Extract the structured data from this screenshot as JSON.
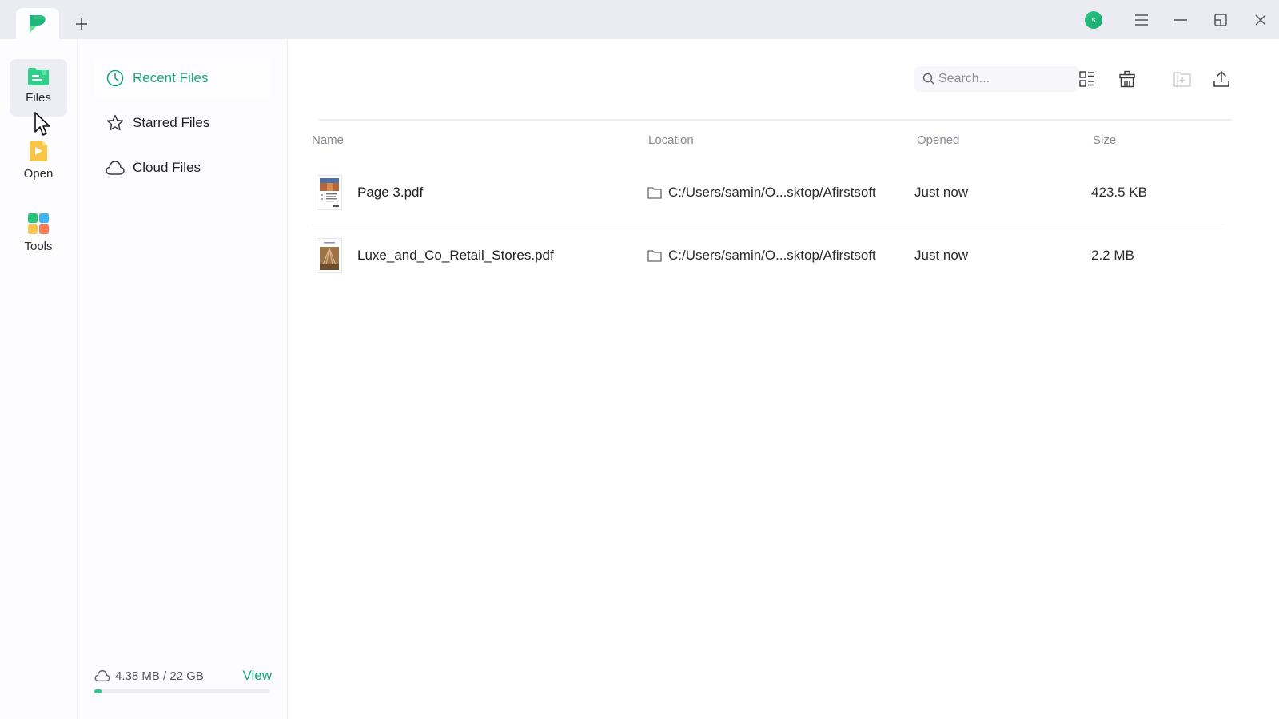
{
  "titlebar": {
    "add_tab_label": "+",
    "avatar_initial": "s",
    "controls": [
      "menu",
      "minimize",
      "restore",
      "close"
    ]
  },
  "colors": {
    "accent": "#1aa879",
    "titlebar_bg": "#ebebf3",
    "files_icon": "#2fd08a",
    "open_icon": "#f8c549",
    "tools_green": "#22c77a",
    "tools_blue": "#3fb4f5",
    "tools_yellow": "#f8c549",
    "tools_orange": "#fb7b55"
  },
  "rail": {
    "items": [
      {
        "label": "Files",
        "icon": "files-folder-icon",
        "active": true
      },
      {
        "label": "Open",
        "icon": "open-file-icon",
        "active": false
      },
      {
        "label": "Tools",
        "icon": "tools-grid-icon",
        "active": false
      }
    ]
  },
  "sidebar": {
    "items": [
      {
        "label": "Recent Files",
        "icon": "clock-icon",
        "active": true
      },
      {
        "label": "Starred Files",
        "icon": "star-icon",
        "active": false
      },
      {
        "label": "Cloud Files",
        "icon": "cloud-icon",
        "active": false
      }
    ],
    "storage": {
      "used_text": "4.38 MB / 22 GB",
      "view_label": "View",
      "used_fraction": 0.0002
    }
  },
  "toolbar": {
    "search_placeholder": "Search...",
    "buttons": [
      "list-view",
      "clear-history",
      "new-folder",
      "upload"
    ]
  },
  "table": {
    "headers": {
      "name": "Name",
      "location": "Location",
      "opened": "Opened",
      "size": "Size"
    },
    "rows": [
      {
        "name": "Page 3.pdf",
        "location": "C:/Users/samin/O...sktop/Afirstsoft",
        "opened": "Just now",
        "size": "423.5 KB"
      },
      {
        "name": "Luxe_and_Co_Retail_Stores.pdf",
        "location": "C:/Users/samin/O...sktop/Afirstsoft",
        "opened": "Just now",
        "size": "2.2 MB"
      }
    ]
  }
}
